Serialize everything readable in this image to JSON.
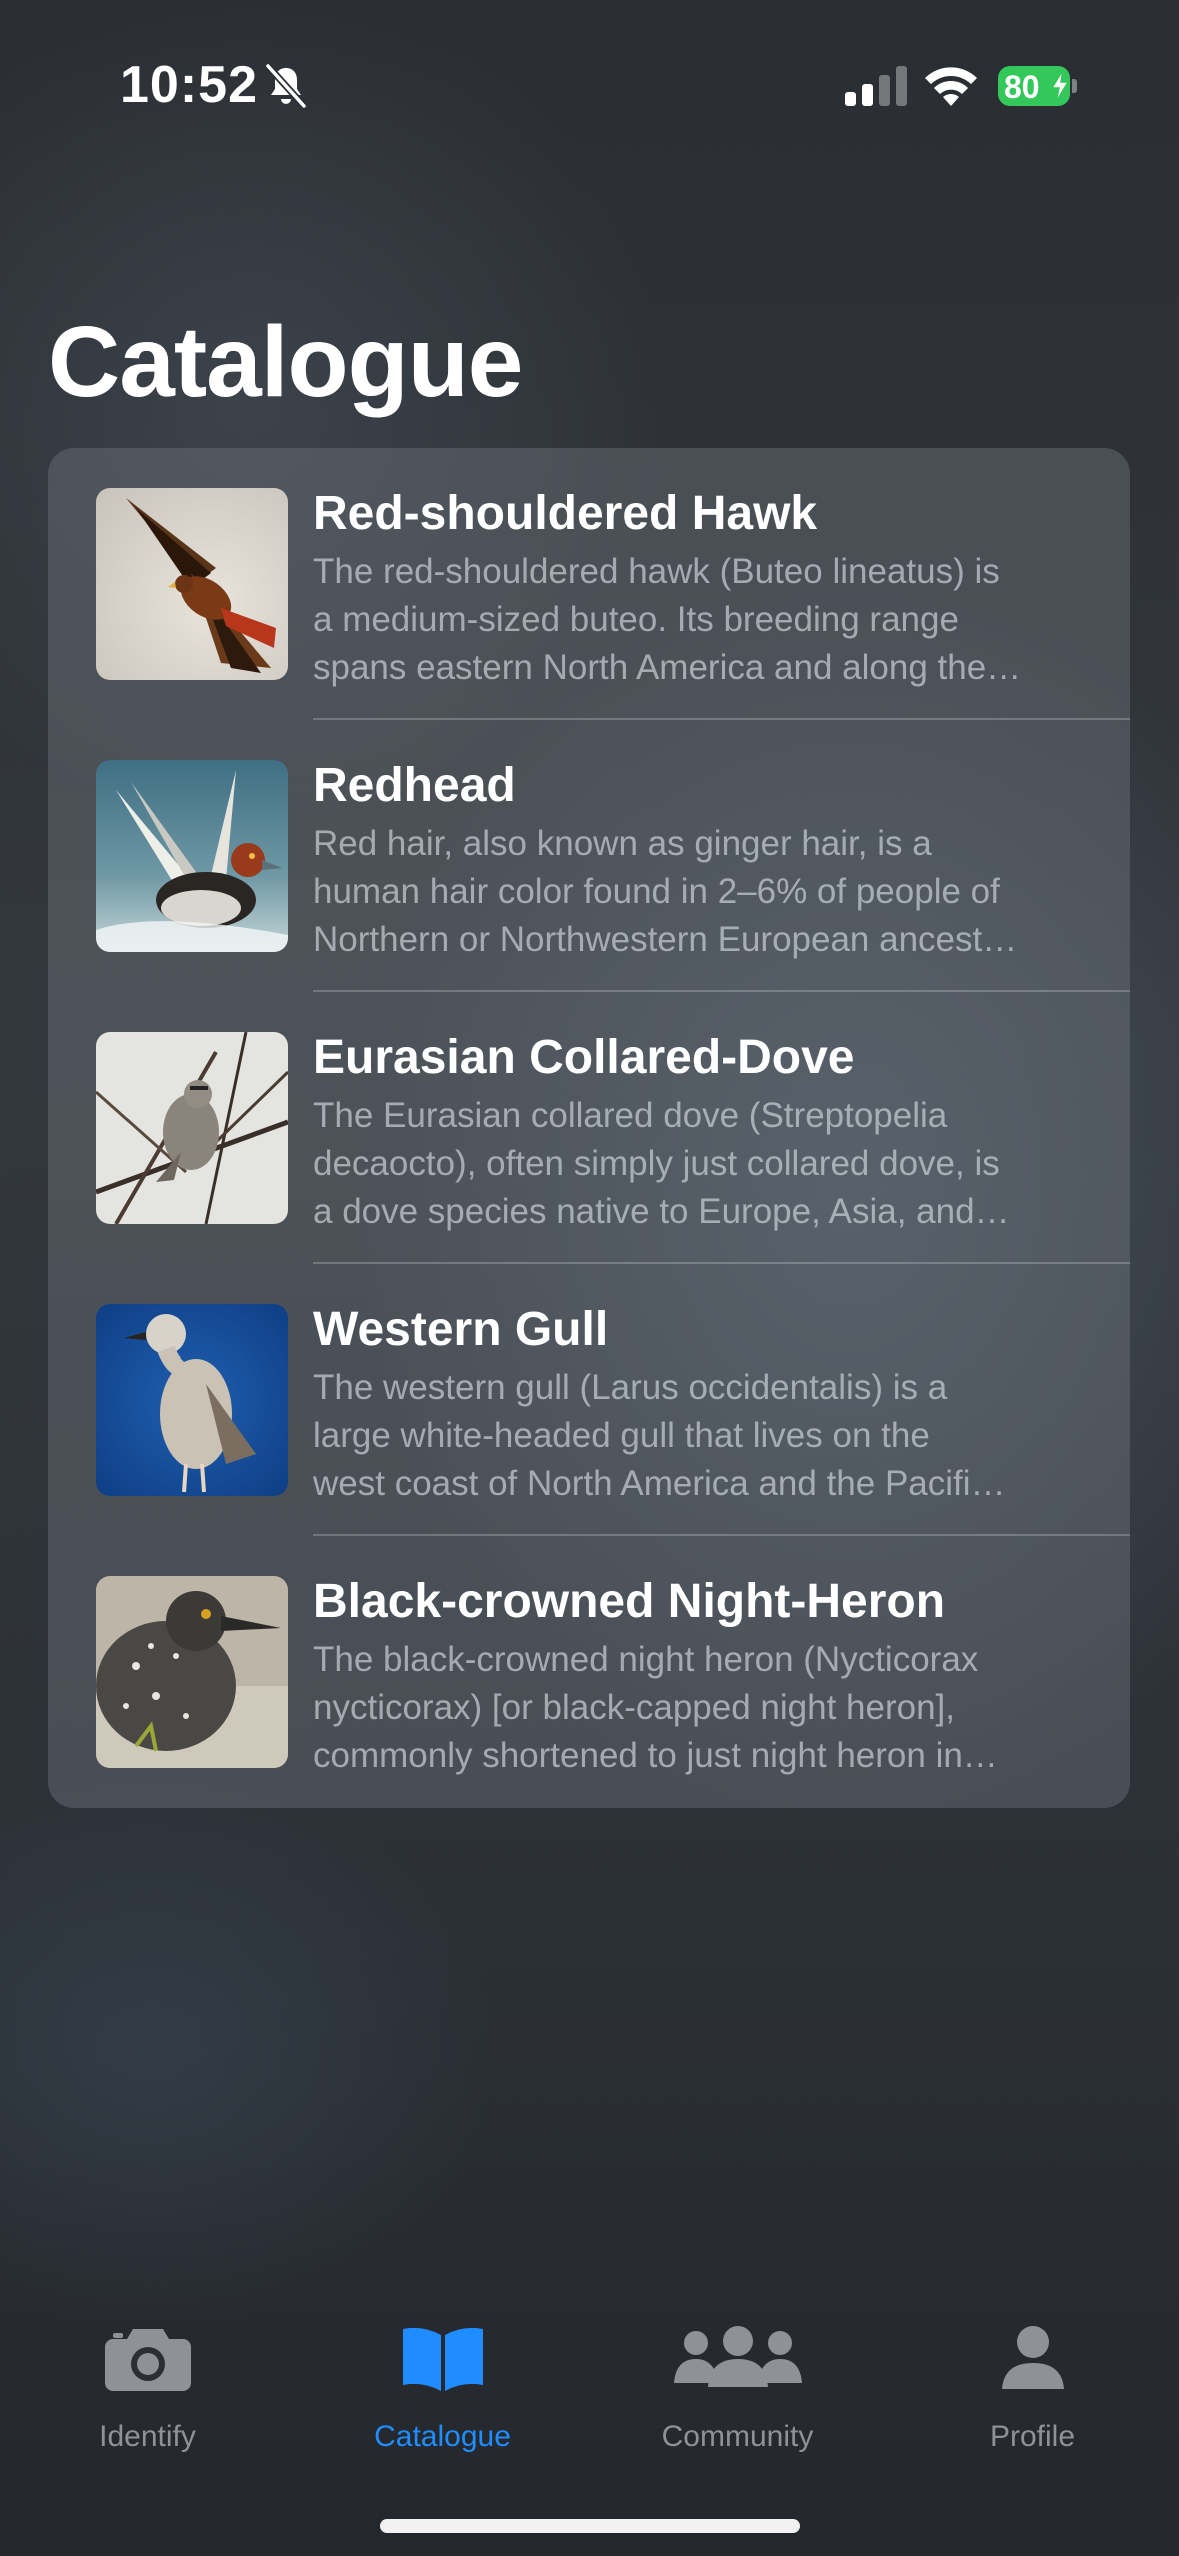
{
  "status_bar": {
    "time": "10:52",
    "battery": "80"
  },
  "page": {
    "title": "Catalogue"
  },
  "items": [
    {
      "title": "Red-shouldered Hawk",
      "description": "The red-shouldered hawk (Buteo lineatus) is\na medium-sized buteo. Its breeding range\nspans eastern North America and along the…"
    },
    {
      "title": "Redhead",
      "description": "Red hair, also known as ginger hair, is a\nhuman hair color found in 2–6% of people of\nNorthern or Northwestern European ancest…"
    },
    {
      "title": "Eurasian Collared-Dove",
      "description": "The Eurasian collared dove (Streptopelia\ndecaocto), often simply just collared dove, is\na dove species native to Europe, Asia, and…"
    },
    {
      "title": "Western Gull",
      "description": "The western gull (Larus occidentalis) is a\nlarge white-headed gull that lives on the\nwest coast of North America and the Pacifi…"
    },
    {
      "title": "Black-crowned Night-Heron",
      "description": "The black-crowned night heron (Nycticorax\nnycticorax) [or black-capped night heron],\ncommonly shortened to just night heron in…"
    }
  ],
  "tabs": [
    {
      "label": "Identify",
      "icon": "camera-icon"
    },
    {
      "label": "Catalogue",
      "icon": "book-icon",
      "active": true
    },
    {
      "label": "Community",
      "icon": "people-icon"
    },
    {
      "label": "Profile",
      "icon": "person-icon"
    }
  ],
  "colors": {
    "accent": "#1f8cff",
    "battery": "#34c759",
    "inactive_tab": "#8e9298"
  }
}
